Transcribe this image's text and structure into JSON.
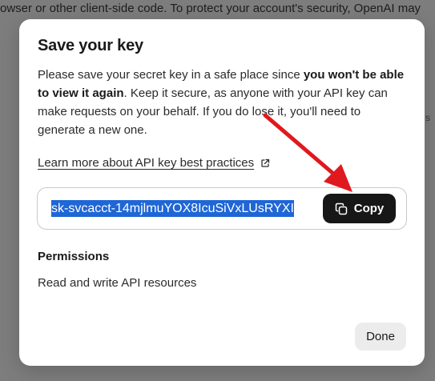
{
  "backdrop": {
    "text": "owser or other client-side code. To protect your account's security, OpenAI may"
  },
  "modal": {
    "title": "Save your key",
    "description_part1": "Please save your secret key in a safe place since ",
    "description_bold": "you won't be able to view it again",
    "description_part2": ". Keep it secure, as anyone with your API key can make requests on your behalf. If you do lose it, you'll need to generate a new one.",
    "learn_link": "Learn more about API key best practices",
    "key_value": "sk-svcacct-14mjlmuYOX8IcuSiVxLUsRYXI",
    "copy_label": "Copy",
    "permissions_label": "Permissions",
    "permissions_value": "Read and write API resources",
    "done_label": "Done"
  },
  "icons": {
    "external_link": "external-link-icon",
    "copy": "copy-icon"
  },
  "colors": {
    "accent_selection": "#1f66d6",
    "copy_button": "#171717",
    "annotation_arrow": "#e0191f"
  }
}
